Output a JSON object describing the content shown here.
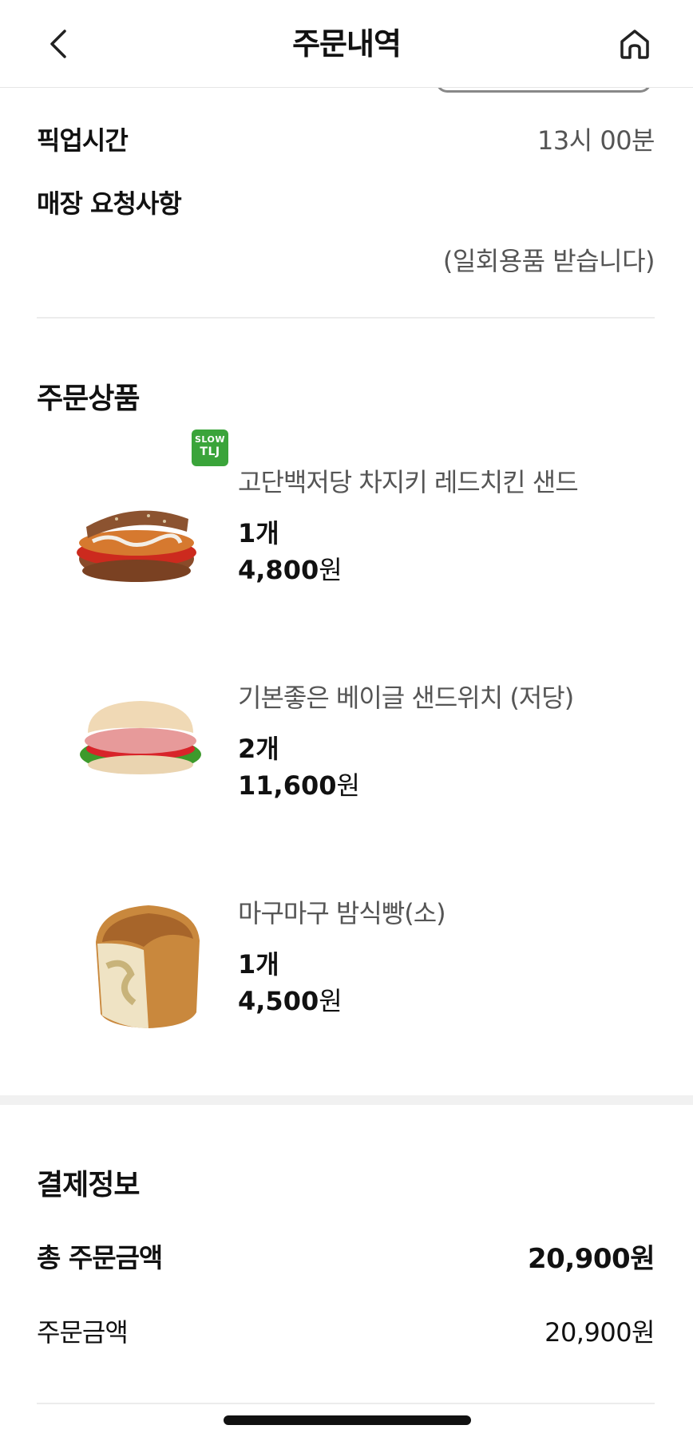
{
  "header": {
    "title": "주문내역",
    "back_icon": "chevron-left-icon",
    "home_icon": "home-icon"
  },
  "store_info": {
    "pickup_label": "픽업시간",
    "pickup_value": "13시 00분",
    "request_label": "매장 요청사항",
    "request_value": "(일회용품 받습니다)"
  },
  "order_items": {
    "section_title": "주문상품",
    "items": [
      {
        "name": "고단백저당 차지키 레드치킨 샌드",
        "qty": "1개",
        "price": "4,800",
        "unit": "원",
        "image": "chicken-sandwich-image",
        "badge_top": "SLOW",
        "badge_bottom": "TLJ"
      },
      {
        "name": "기본좋은 베이글 샌드위치 (저당)",
        "qty": "2개",
        "price": "11,600",
        "unit": "원",
        "image": "bagel-sandwich-image"
      },
      {
        "name": "마구마구 밤식빵(소)",
        "qty": "1개",
        "price": "4,500",
        "unit": "원",
        "image": "chestnut-bread-image"
      }
    ]
  },
  "payment": {
    "section_title": "결제정보",
    "total_label": "총 주문금액",
    "total_value": "20,900원",
    "order_label": "주문금액",
    "order_value": "20,900원"
  },
  "colors": {
    "badge_green": "#3aa43a",
    "text_primary": "#111111",
    "text_secondary": "#555555"
  }
}
